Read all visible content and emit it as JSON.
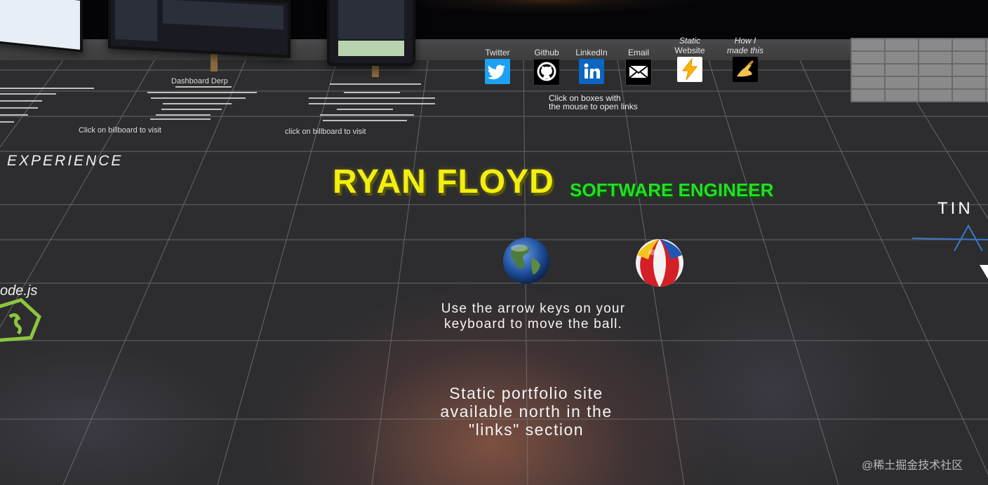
{
  "links": {
    "twitter": "Twitter",
    "github": "Github",
    "linkedin": "LinkedIn",
    "email": "Email",
    "static_website": [
      "Static",
      "Website"
    ],
    "how_made": [
      "How I",
      "made this"
    ],
    "click_hint": [
      "Click on boxes with",
      "the mouse to open links"
    ]
  },
  "header": {
    "name": "RYAN FLOYD",
    "role": "SOFTWARE ENGINEER"
  },
  "instructions": [
    "Use the arrow keys on your",
    "keyboard to move the ball."
  ],
  "static_note": [
    "Static portfolio site",
    "available north in the",
    "\"links\" section"
  ],
  "sections": {
    "experience": "EXPERIENCE",
    "node": "ode.js",
    "timeline": "TIN"
  },
  "projects": {
    "dashboard_title": "Dashboard Derp",
    "billboard_hint_1": "Click on billboard to visit",
    "billboard_hint_2": "click on billboard to visit"
  },
  "watermark": "@稀土掘金技术社区",
  "colors": {
    "name": "#f3ee10",
    "role": "#22e022",
    "floor": "#2d2d2f",
    "grid": "#7a7a7a",
    "twitter": "#1da1f2",
    "linkedin": "#0a66c2"
  },
  "icons": [
    "twitter-icon",
    "github-icon",
    "linkedin-icon",
    "email-icon",
    "lightning-icon",
    "writing-hand-icon",
    "globe-ball",
    "beach-ball",
    "nodejs-logo-icon"
  ]
}
